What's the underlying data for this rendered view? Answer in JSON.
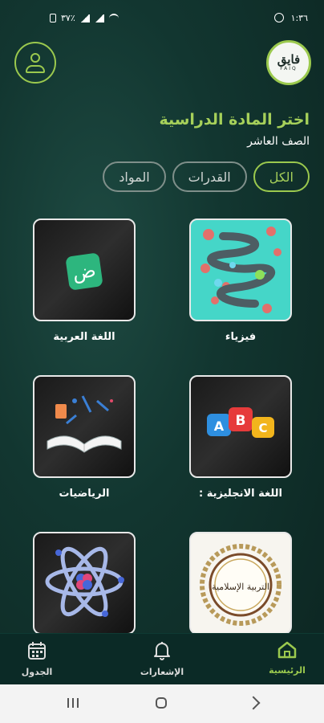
{
  "status_bar": {
    "time": "١:٣٦",
    "left_text": "٣٧٪"
  },
  "logo": {
    "text": "فايق",
    "sub": "FAIQ"
  },
  "header": {
    "title": "اختر المادة الدراسية",
    "subtitle": "الصف العاشر"
  },
  "filters": [
    {
      "label": "الكل",
      "active": true
    },
    {
      "label": "القدرات",
      "active": false
    },
    {
      "label": "المواد",
      "active": false
    }
  ],
  "subjects": [
    {
      "label": "فيزياء"
    },
    {
      "label": "اللغة العربية"
    },
    {
      "label": "اللغة الانجليزية :"
    },
    {
      "label": "الرياضيات"
    },
    {
      "label": ""
    },
    {
      "label": ""
    }
  ],
  "arabic_icon_letter": "ض",
  "abc_letters": [
    "A",
    "B",
    "C"
  ],
  "islamic_text": "التربية الإسلامية",
  "bottom_nav": [
    {
      "label": "الرئيسية",
      "icon": "home-icon",
      "active": true
    },
    {
      "label": "الإشعارات",
      "icon": "bell-icon",
      "active": false
    },
    {
      "label": "الجدول",
      "icon": "calendar-icon",
      "active": false
    }
  ],
  "colors": {
    "accent": "#9bc94e",
    "background": "#123630",
    "nav_bg": "#0b2a26"
  }
}
